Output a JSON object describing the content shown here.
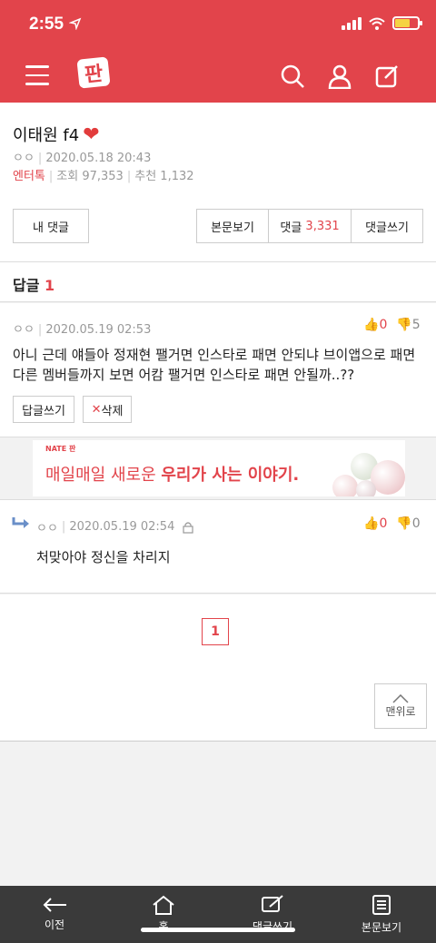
{
  "status": {
    "time": "2:55"
  },
  "post": {
    "title": "이태원 f4",
    "author": "ㅇㅇ",
    "datetime": "2020.05.18 20:43",
    "category": "엔터톡",
    "views_label": "조회",
    "views": "97,353",
    "recommend_label": "추천",
    "recommend": "1,132"
  },
  "actions": {
    "my_comments": "내 댓글",
    "view_post": "본문보기",
    "comments_label": "댓글",
    "comments_count": "3,331",
    "write_comment": "댓글쓰기"
  },
  "replies": {
    "label": "답글",
    "count": "1"
  },
  "comment": {
    "author": "ㅇㅇ",
    "datetime": "2020.05.19 02:53",
    "text": "아니 근데 얘들아 정재현 팰거면 인스타로 패면 안되냐 브이앱으로 패면 다른 멤버들까지 보면 어캄 팰거면 인스타로 패면 안될까..??",
    "up": "0",
    "down": "5",
    "reply_button": "답글쓰기",
    "delete_button": "삭제"
  },
  "ad": {
    "brand": "NATE 판",
    "text_plain": "매일매일 새로운 ",
    "text_bold": "우리가 사는 이야기."
  },
  "reply": {
    "author": "ㅇㅇ",
    "datetime": "2020.05.19 02:54",
    "text": "처맞아야 정신을 차리지",
    "up": "0",
    "down": "0"
  },
  "pagination": {
    "current": "1"
  },
  "to_top": "맨위로",
  "bottom_nav": [
    {
      "label": "이전",
      "icon": "back-arrow-icon"
    },
    {
      "label": "홈",
      "icon": "home-icon"
    },
    {
      "label": "댓글쓰기",
      "icon": "compose-icon"
    },
    {
      "label": "본문보기",
      "icon": "document-icon"
    }
  ],
  "colors": {
    "brand": "#e2444b",
    "bottom_bar": "#3a3a3a"
  }
}
